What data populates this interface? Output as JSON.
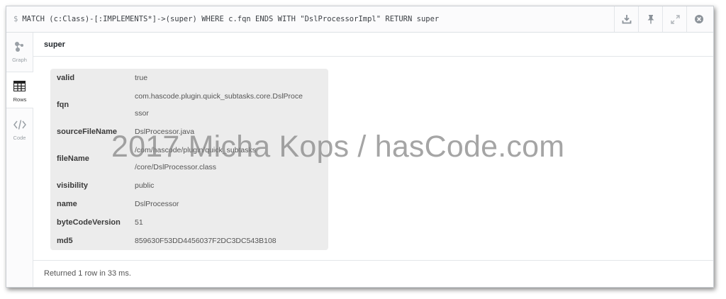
{
  "command": {
    "prompt": "$",
    "query": "MATCH (c:Class)-[:IMPLEMENTS*]->(super) WHERE c.fqn ENDS WITH \"DslProcessorImpl\" RETURN super"
  },
  "toolbar": {
    "icons": [
      "download-icon",
      "pin-icon",
      "expand-icon",
      "close-icon"
    ]
  },
  "sidebar": {
    "items": [
      {
        "label": "Graph",
        "icon": "graph-icon",
        "active": false
      },
      {
        "label": "Rows",
        "icon": "table-icon",
        "active": true
      },
      {
        "label": "Code",
        "icon": "code-icon",
        "active": false
      }
    ]
  },
  "result": {
    "column": "super",
    "rows": [
      {
        "key": "valid",
        "value": "true"
      },
      {
        "key": "fqn",
        "value_lines": [
          "com.hascode.plugin.quick_subtasks.core.DslProce",
          "ssor"
        ]
      },
      {
        "key": "sourceFileName",
        "value": "DslProcessor.java"
      },
      {
        "key": "fileName",
        "value_lines": [
          "/com/hascode/plugin/quick_subtasks",
          "/core/DslProcessor.class"
        ]
      },
      {
        "key": "visibility",
        "value": "public"
      },
      {
        "key": "name",
        "value": "DslProcessor"
      },
      {
        "key": "byteCodeVersion",
        "value": "51"
      },
      {
        "key": "md5",
        "value": "859630F53DD4456037F2DC3DC543B108"
      }
    ]
  },
  "footer": {
    "status": "Returned 1 row in 33 ms."
  },
  "watermark": "2017 Micha Kops / hasCode.com"
}
